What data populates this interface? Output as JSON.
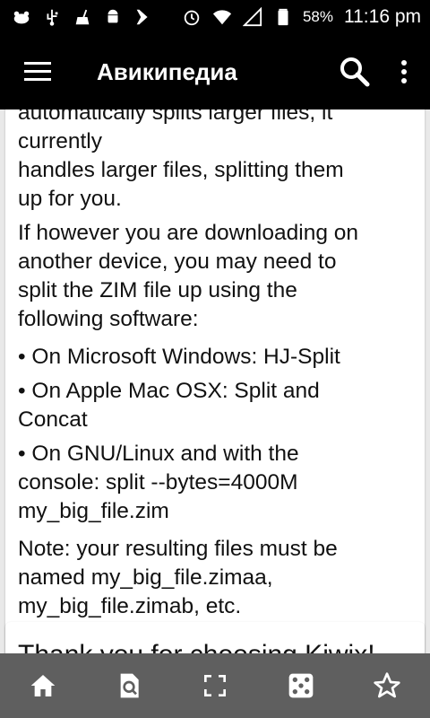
{
  "status_bar": {
    "battery_percent": "58%",
    "time": "11:16 pm",
    "icons": [
      "cat-notification-icon",
      "usb-icon",
      "cleaner-icon",
      "android-icon",
      "checkmark-flag-icon",
      "alarm-icon",
      "wifi-icon",
      "signal-icon",
      "battery-icon"
    ]
  },
  "app_bar": {
    "title": "Авикипедиа",
    "menu_icon": "hamburger-menu-icon",
    "search_icon": "search-icon",
    "more_icon": "more-vertical-icon"
  },
  "article": {
    "partial_line": "automatically splits larger files, it currently",
    "lines": [
      "handles larger files, splitting them",
      "up for you."
    ],
    "para2": [
      "If however you are downloading on",
      "another device, you may need to",
      "split the ZIM file up using the",
      "following software:"
    ],
    "bullets": [
      [
        "• On Microsoft Windows: HJ-Split"
      ],
      [
        "• On Apple Mac OSX: Split and",
        "Concat"
      ],
      [
        "• On GNU/Linux and with the",
        "console: split --bytes=4000M",
        "my_big_file.zim"
      ]
    ],
    "note": [
      "Note: your resulting files must be",
      "named my_big_file.zimaa,",
      "my_big_file.zimab, etc."
    ]
  },
  "next_card": {
    "heading": "Thank you for choosing Kiwix!"
  },
  "bottom_bar": {
    "buttons": [
      "home-icon",
      "find-in-page-icon",
      "fullscreen-icon",
      "random-dice-icon",
      "bookmark-star-icon"
    ],
    "color": "#5f5f5f"
  }
}
